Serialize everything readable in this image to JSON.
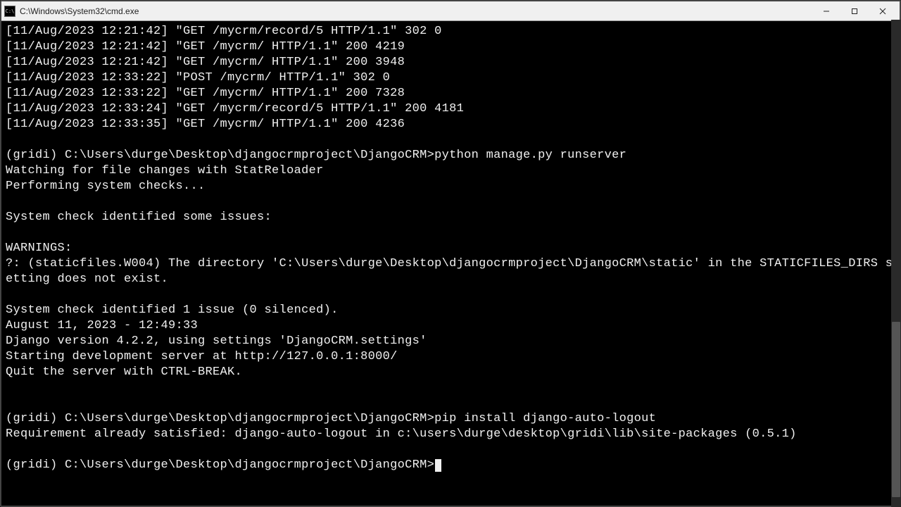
{
  "window": {
    "title": "C:\\Windows\\System32\\cmd.exe"
  },
  "terminal": {
    "lines": [
      "[11/Aug/2023 12:21:42] \"GET /mycrm/record/5 HTTP/1.1\" 302 0",
      "[11/Aug/2023 12:21:42] \"GET /mycrm/ HTTP/1.1\" 200 4219",
      "[11/Aug/2023 12:21:42] \"GET /mycrm/ HTTP/1.1\" 200 3948",
      "[11/Aug/2023 12:33:22] \"POST /mycrm/ HTTP/1.1\" 302 0",
      "[11/Aug/2023 12:33:22] \"GET /mycrm/ HTTP/1.1\" 200 7328",
      "[11/Aug/2023 12:33:24] \"GET /mycrm/record/5 HTTP/1.1\" 200 4181",
      "[11/Aug/2023 12:33:35] \"GET /mycrm/ HTTP/1.1\" 200 4236",
      "",
      "(gridi) C:\\Users\\durge\\Desktop\\djangocrmproject\\DjangoCRM>python manage.py runserver",
      "Watching for file changes with StatReloader",
      "Performing system checks...",
      "",
      "System check identified some issues:",
      "",
      "WARNINGS:",
      "?: (staticfiles.W004) The directory 'C:\\Users\\durge\\Desktop\\djangocrmproject\\DjangoCRM\\static' in the STATICFILES_DIRS setting does not exist.",
      "",
      "System check identified 1 issue (0 silenced).",
      "August 11, 2023 - 12:49:33",
      "Django version 4.2.2, using settings 'DjangoCRM.settings'",
      "Starting development server at http://127.0.0.1:8000/",
      "Quit the server with CTRL-BREAK.",
      "",
      "",
      "(gridi) C:\\Users\\durge\\Desktop\\djangocrmproject\\DjangoCRM>pip install django-auto-logout",
      "Requirement already satisfied: django-auto-logout in c:\\users\\durge\\desktop\\gridi\\lib\\site-packages (0.5.1)",
      "",
      "(gridi) C:\\Users\\durge\\Desktop\\djangocrmproject\\DjangoCRM>"
    ]
  }
}
